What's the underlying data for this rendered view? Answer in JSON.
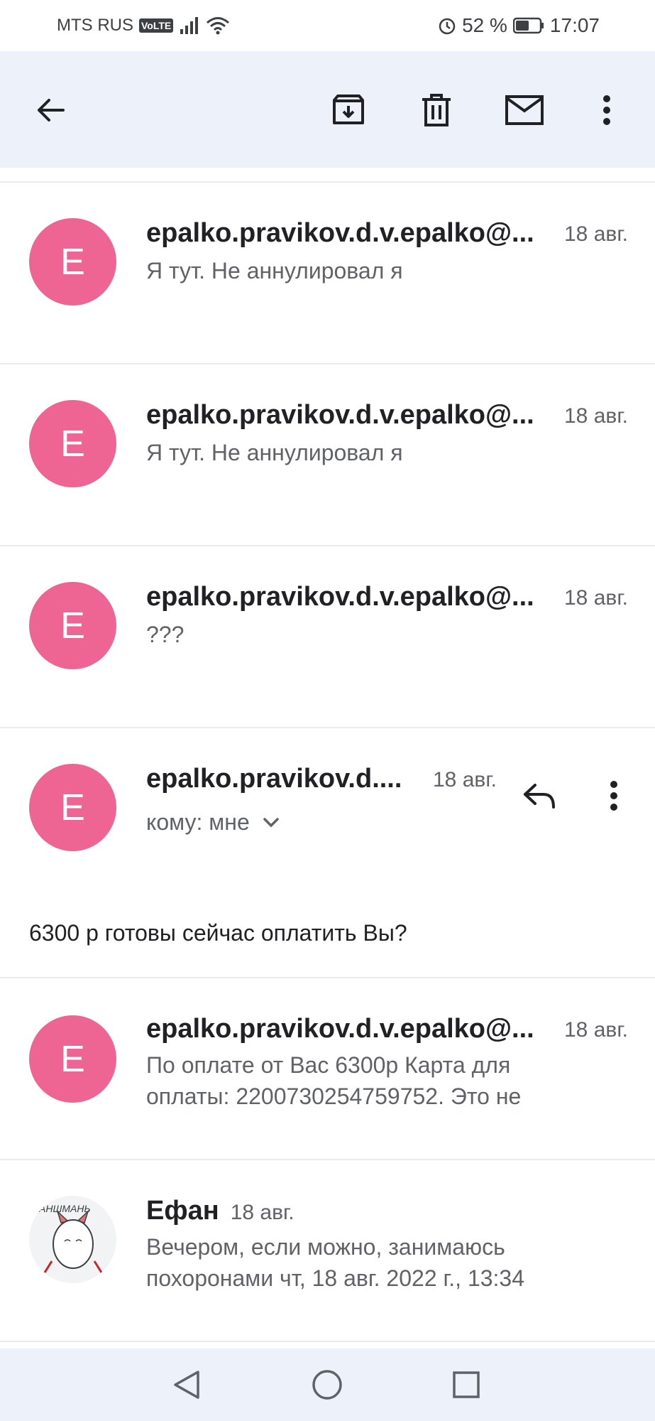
{
  "status": {
    "carrier": "MTS RUS",
    "volte": "VoLTE",
    "battery": "52 %",
    "time": "17:07"
  },
  "toolbar": {
    "back": "back-arrow-icon",
    "archive": "archive-icon",
    "delete": "trash-icon",
    "mark_unread": "mail-icon",
    "more": "more-vert-icon"
  },
  "messages": [
    {
      "avatar": "E",
      "sender": "epalko.pravikov.d.v.epalko@...",
      "date": "18 авг.",
      "snippet": "Я тут. Не аннулировал я"
    },
    {
      "avatar": "E",
      "sender": "epalko.pravikov.d.v.epalko@...",
      "date": "18 авг.",
      "snippet": "Я тут. Не аннулировал я"
    },
    {
      "avatar": "E",
      "sender": "epalko.pravikov.d.v.epalko@...",
      "date": "18 авг.",
      "snippet": "???"
    }
  ],
  "expanded": {
    "avatar": "E",
    "sender": "epalko.pravikov.d....",
    "date": "18 авг.",
    "recipient": "кому: мне",
    "body": "6300 р готовы сейчас оплатить Вы?"
  },
  "after": [
    {
      "avatar": "E",
      "sender": "epalko.pravikov.d.v.epalko@...",
      "date": "18 авг.",
      "snippet_line1": "По оплате от Вас 6300р Карта для",
      "snippet_line2": "оплаты: 2200730254759752. Это не"
    },
    {
      "sender": "Ефан",
      "date": "18 авг.",
      "snippet_line1": "Вечером, если можно, занимаюсь",
      "snippet_line2": "похоронами чт, 18 авг. 2022 г., 13:34",
      "avatar_caption": "АНШМАНЬ"
    }
  ],
  "colors": {
    "avatar": "#ee6593",
    "appbar": "#edf2fa"
  }
}
